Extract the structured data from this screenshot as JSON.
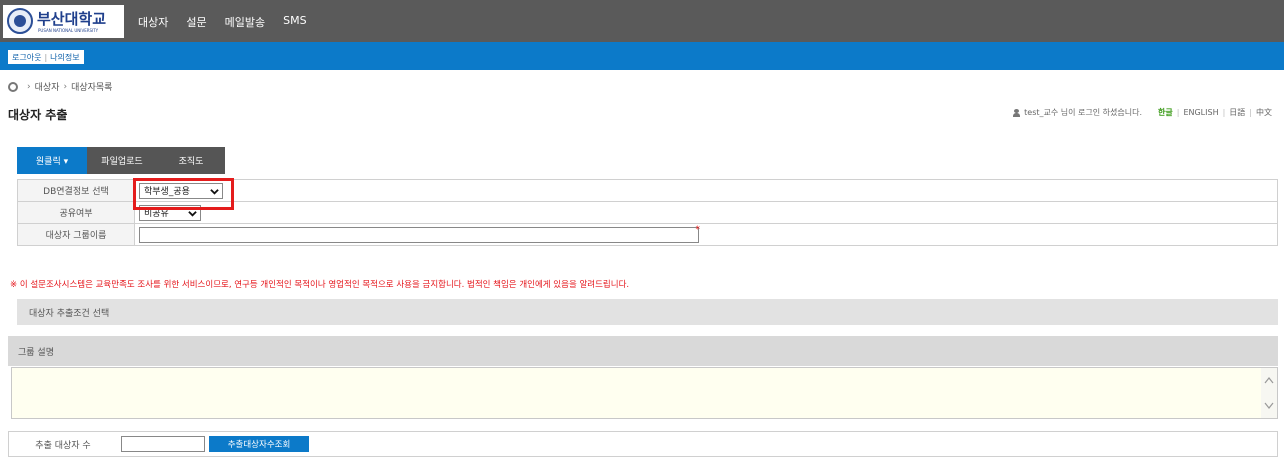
{
  "header": {
    "logo_title": "부산대학교",
    "logo_subtitle": "PUSAN NATIONAL UNIVERSITY",
    "nav": [
      "대상자",
      "설문",
      "메일발송",
      "SMS"
    ]
  },
  "account_bar": {
    "logout_label": "로그아웃",
    "myinfo_label": "나의정보"
  },
  "breadcrumb": {
    "items": [
      "대상자",
      "대상자목록"
    ]
  },
  "page": {
    "title": "대상자 추출"
  },
  "login_info": {
    "message": "test_교수 님이 로그인 하셨습니다.",
    "languages": [
      "한글",
      "ENGLISH",
      "日語",
      "中文"
    ]
  },
  "tabs": {
    "items": [
      "원클릭 ▾",
      "파일업로드",
      "조직도"
    ]
  },
  "form": {
    "db_label": "DB연결정보 선택",
    "db_value": "학부생_공용",
    "share_label": "공유여부",
    "share_value": "비공유",
    "group_name_label": "대상자 그룹이름",
    "group_name_value": "",
    "required_mark": "*"
  },
  "notice": "※ 이 설문조사시스템은 교육만족도 조사를 위한 서비스이므로, 연구등 개인적인 목적이나 영업적인 목적으로 사용을 금지합니다. 법적인 책임은 개인에게 있음을 알려드립니다.",
  "section": {
    "condition_label": "대상자 추출조건 선택",
    "group_desc_label": "그룹 설명"
  },
  "count": {
    "label": "추출 대상자 수",
    "value": "",
    "button_label": "추출대상자수조회"
  },
  "colors": {
    "topbar": "#5a5a5a",
    "brand_blue": "#0c7ac9",
    "highlight_red": "#e41c1c",
    "notice_red": "#e5151b"
  }
}
